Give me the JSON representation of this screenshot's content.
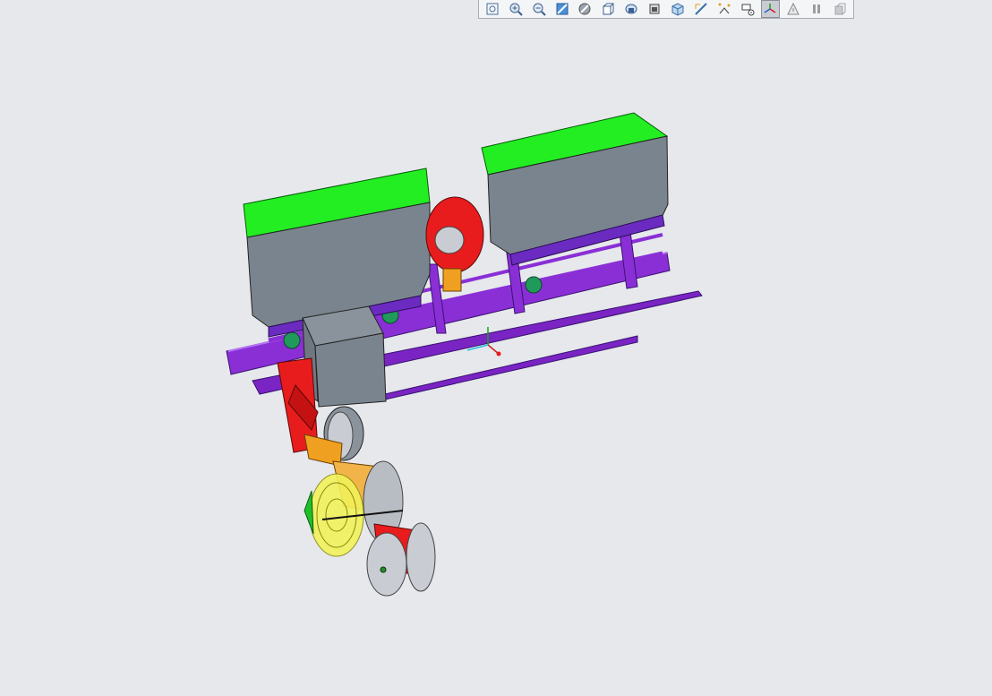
{
  "toolbar": {
    "buttons": [
      {
        "name": "refit-view-icon",
        "active": false
      },
      {
        "name": "zoom-in-icon",
        "active": false
      },
      {
        "name": "zoom-out-icon",
        "active": false
      },
      {
        "name": "repaint-icon",
        "active": false
      },
      {
        "name": "display-style-icon",
        "active": false
      },
      {
        "name": "saved-views-icon",
        "active": false
      },
      {
        "name": "view-manager-icon",
        "active": false
      },
      {
        "name": "perspective-icon",
        "active": false
      },
      {
        "name": "named-view-icon",
        "active": false
      },
      {
        "name": "datum-planes-icon",
        "active": false
      },
      {
        "name": "datum-points-icon",
        "active": false
      },
      {
        "name": "annotation-display-icon",
        "active": false
      },
      {
        "name": "coordinate-system-icon",
        "active": true
      },
      {
        "name": "spin-center-icon",
        "active": false
      },
      {
        "name": "pause-icon",
        "active": false
      },
      {
        "name": "disabled-tool-icon",
        "active": false
      }
    ]
  },
  "colors": {
    "background": "#e6e8ec",
    "hopper_lid": "#22ee22",
    "hopper_body": "#7a848e",
    "frame": "#8a2fd6",
    "bracket": "#e81c1c",
    "link": "#f0a020",
    "gauge_wheel": "#f2f25a"
  }
}
